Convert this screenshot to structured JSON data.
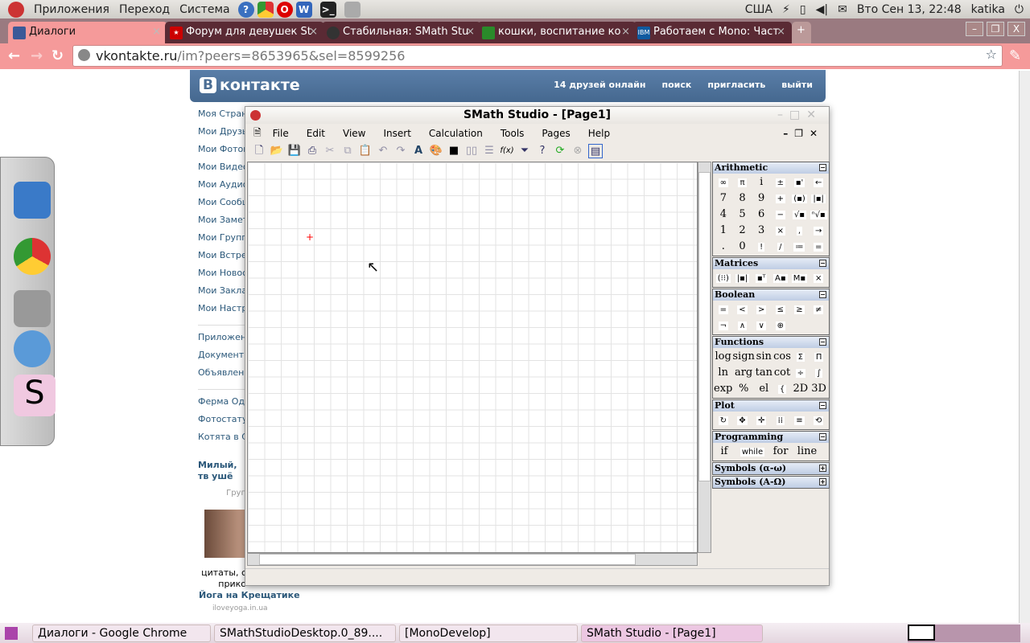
{
  "top_panel": {
    "menus": [
      "Приложения",
      "Переход",
      "Система"
    ],
    "launchers": [
      "help-icon",
      "chrome-icon",
      "opera-icon",
      "word-icon",
      "terminal-icon",
      "screenshot-icon"
    ],
    "keyboard": "США",
    "clock": "Вто Сен 13, 22:48",
    "user": "katika"
  },
  "browser": {
    "tabs": [
      {
        "title": "Диалоги",
        "active": true,
        "icon": "vk-icon",
        "color": "#3b5998"
      },
      {
        "title": "Форум для девушек St",
        "icon": "star-icon",
        "color": "#cc0000"
      },
      {
        "title": "Стабильная: SMath Stu",
        "icon": "globe-icon",
        "color": "#333333"
      },
      {
        "title": "кошки, воспитание ко",
        "icon": "paw-icon",
        "color": "#2a8a2a"
      },
      {
        "title": "Работаем с Mono: Част",
        "icon": "ibm-icon",
        "color": "#0f5aa0"
      }
    ],
    "url_host": "vkontakte.ru",
    "url_path": "/im?peers=8653965&sel=8599256"
  },
  "vk": {
    "logo": "контакте",
    "logo_b": "В",
    "nav": [
      "14 друзей онлайн",
      "поиск",
      "пригласить",
      "выйти"
    ],
    "menu": [
      "Моя Страница",
      "Мои Друзья",
      "Мои Фотографии",
      "Мои Видеозаписи",
      "Мои Аудиозаписи",
      "Мои Сообщения",
      "Мои Заметки",
      "Мои Группы",
      "Мои Встречи",
      "Мои Новости",
      "Мои Закладки",
      "Мои Настройки"
    ],
    "menu2": [
      "Приложения",
      "Документы",
      "Объявления"
    ],
    "menu3": [
      "Ферма Оде",
      "Фотостатус",
      "Котята в Ст"
    ],
    "ad1_title": "Милый, тв ушё",
    "ad1_sub": "Груп",
    "ad2_caption": "цитаты, с прико",
    "ad3_title": "Йога на Крещатике",
    "ad3_site": "iloveyoga.in.ua"
  },
  "smath": {
    "title": "SMath Studio - [Page1]",
    "menu": [
      "File",
      "Edit",
      "View",
      "Insert",
      "Calculation",
      "Tools",
      "Pages",
      "Help"
    ],
    "toolbar": [
      "new",
      "open",
      "save",
      "print",
      "|",
      "cut",
      "copy",
      "paste",
      "|",
      "undo",
      "redo",
      "|",
      "text",
      "color",
      "border",
      "|",
      "align-h",
      "align-v",
      "|",
      "f(x)",
      "filter",
      "help",
      "|",
      "refresh",
      "stop",
      "|",
      "panel"
    ],
    "panel": [
      {
        "name": "Arithmetic",
        "collapsed": false,
        "cells": [
          "∞",
          "π",
          "i",
          "±",
          "▪'",
          "←",
          "7",
          "8",
          "9",
          "+",
          "(▪)",
          "|▪|",
          "4",
          "5",
          "6",
          "−",
          "√▪",
          "ⁿ√▪",
          "1",
          "2",
          "3",
          "×",
          ",",
          "→",
          ".",
          "0",
          "!",
          "/",
          "≔",
          "="
        ]
      },
      {
        "name": "Matrices",
        "collapsed": false,
        "cells": [
          "(⁝⁝)",
          "|▪|",
          "▪ᵀ",
          "A▪",
          "M▪",
          "⨯"
        ]
      },
      {
        "name": "Boolean",
        "collapsed": false,
        "cells": [
          "=",
          "<",
          ">",
          "≤",
          "≥",
          "≠",
          "¬",
          "∧",
          "∨",
          "⊕"
        ]
      },
      {
        "name": "Functions",
        "collapsed": false,
        "cells": [
          "log",
          "sign",
          "sin",
          "cos",
          "Σ",
          "Π",
          "ln",
          "arg",
          "tan",
          "cot",
          "÷",
          "∫",
          "exp",
          "%",
          "el",
          "{",
          "2D",
          "3D"
        ]
      },
      {
        "name": "Plot",
        "collapsed": false,
        "cells": [
          "↻",
          "✥",
          "✛",
          "⁞⁞",
          "≡",
          "⟲"
        ]
      },
      {
        "name": "Programming",
        "collapsed": false,
        "cells": [
          "if",
          "while",
          "for",
          "line"
        ]
      },
      {
        "name": "Symbols (α-ω)",
        "collapsed": true,
        "cells": []
      },
      {
        "name": "Symbols (A-Ω)",
        "collapsed": true,
        "cells": []
      }
    ]
  },
  "taskbar": [
    {
      "label": "Диалоги - Google Chrome",
      "active": false
    },
    {
      "label": "SMathStudioDesktop.0_89....",
      "active": false
    },
    {
      "label": "[MonoDevelop]",
      "active": false
    },
    {
      "label": "SMath Studio - [Page1]",
      "active": true
    }
  ]
}
